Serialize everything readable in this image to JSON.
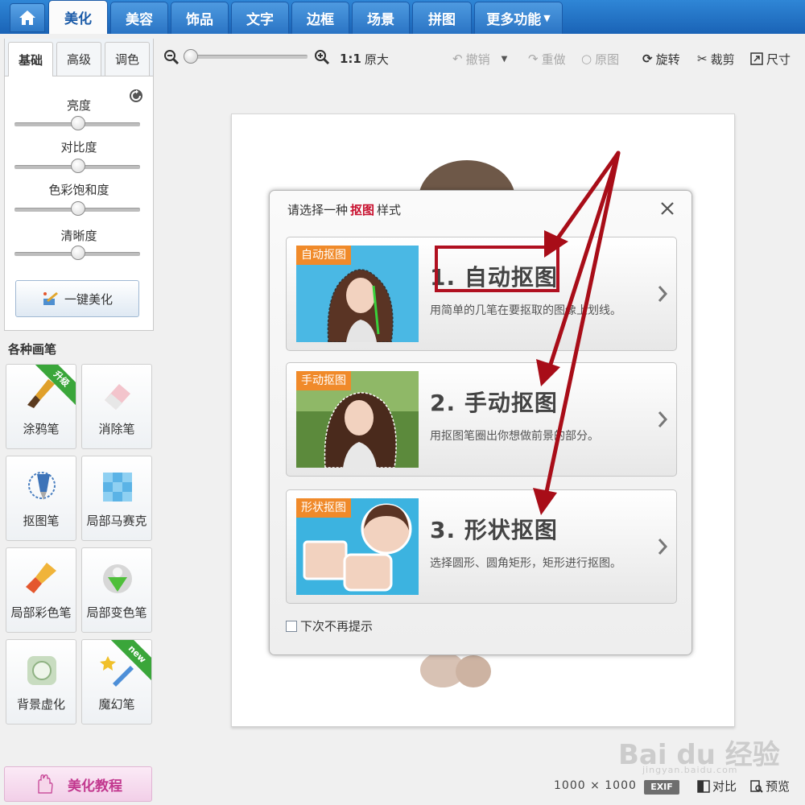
{
  "main_tabs": [
    {
      "label": "美化"
    },
    {
      "label": "美容"
    },
    {
      "label": "饰品"
    },
    {
      "label": "文字"
    },
    {
      "label": "边框"
    },
    {
      "label": "场景"
    },
    {
      "label": "拼图"
    },
    {
      "label": "更多功能"
    }
  ],
  "sub_tabs": [
    {
      "label": "基础"
    },
    {
      "label": "高级"
    },
    {
      "label": "调色"
    }
  ],
  "sliders": [
    {
      "label": "亮度",
      "value": 0.5
    },
    {
      "label": "对比度",
      "value": 0.5
    },
    {
      "label": "色彩饱和度",
      "value": 0.5
    },
    {
      "label": "清晰度",
      "value": 0.5
    }
  ],
  "one_key_label": "一键美化",
  "brushes_title": "各种画笔",
  "brushes": [
    {
      "label": "涂鸦笔",
      "ribbon": "升级"
    },
    {
      "label": "消除笔"
    },
    {
      "label": "抠图笔"
    },
    {
      "label": "局部马赛克"
    },
    {
      "label": "局部彩色笔"
    },
    {
      "label": "局部变色笔"
    },
    {
      "label": "背景虚化"
    },
    {
      "label": "魔幻笔",
      "ribbon": "new"
    }
  ],
  "tutorial_label": "美化教程",
  "toolbar": {
    "zoom_ratio": "1:1",
    "original_size": "原大",
    "undo": "撤销",
    "redo": "重做",
    "original": "原图",
    "rotate": "旋转",
    "crop": "裁剪",
    "size": "尺寸"
  },
  "dialog": {
    "title_prefix": "请选择一种",
    "title_highlight": "抠图",
    "title_suffix": "样式",
    "options": [
      {
        "badge": "自动抠图",
        "title": "1. 自动抠图",
        "desc": "用简单的几笔在要抠取的图像上划线。"
      },
      {
        "badge": "手动抠图",
        "title": "2. 手动抠图",
        "desc": "用抠图笔圈出你想做前景的部分。"
      },
      {
        "badge": "形状抠图",
        "title": "3. 形状抠图",
        "desc": "选择圆形、圆角矩形，矩形进行抠图。"
      }
    ],
    "dont_remind": "下次不再提示"
  },
  "status": {
    "size": "1000 × 1000",
    "exif": "EXIF",
    "compare": "对比",
    "preview": "预览"
  },
  "watermark": {
    "text": "Bai du 经验",
    "url": "jingyan.baidu.com"
  },
  "colors": {
    "tab_blue": "#2a74c4",
    "annotation_red": "#b01020",
    "badge_orange": "#f08a2a",
    "ribbon_green": "#3aa63a"
  }
}
